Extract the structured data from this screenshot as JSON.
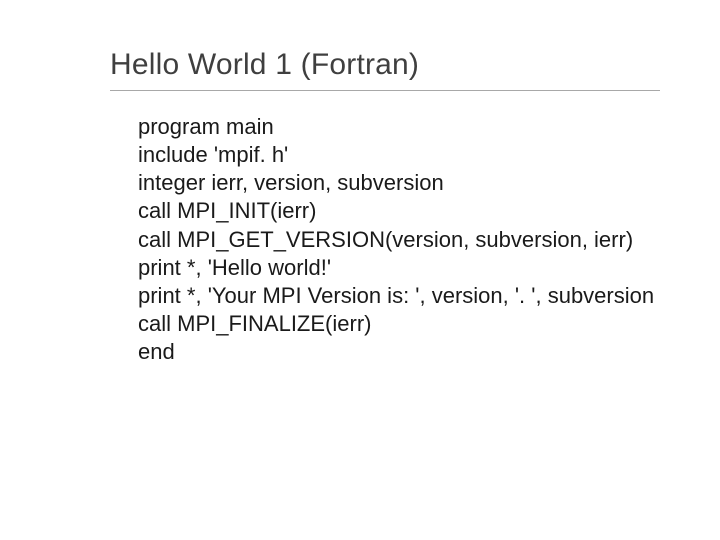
{
  "slide": {
    "title": "Hello World 1 (Fortran)",
    "code": {
      "l0": "program main",
      "l1": "include 'mpif. h'",
      "l2": "integer ierr, version, subversion",
      "l3": "call MPI_INIT(ierr)",
      "l4": "call MPI_GET_VERSION(version, subversion, ierr)",
      "l5": "print *, 'Hello world!'",
      "l6": "print *, 'Your MPI Version is: ', version, '. ', subversion",
      "l7": "call MPI_FINALIZE(ierr)",
      "l8": "end"
    }
  }
}
